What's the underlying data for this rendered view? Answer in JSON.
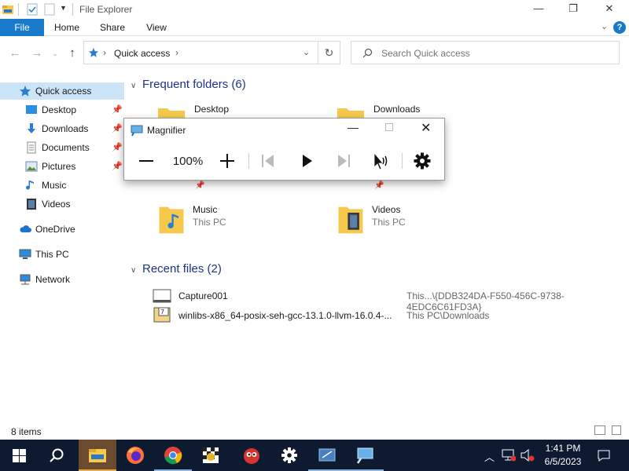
{
  "window": {
    "title": "File Explorer",
    "controls": {
      "minimize": "—",
      "maximize": "❐",
      "close": "✕"
    }
  },
  "ribbon": {
    "tabs": [
      "File",
      "Home",
      "Share",
      "View"
    ],
    "expand_icon": "chevron-down-icon",
    "help": "?"
  },
  "address": {
    "crumb": "Quick access",
    "search_placeholder": "Search Quick access"
  },
  "nav": {
    "quick_access": "Quick access",
    "pinned": [
      {
        "label": "Desktop",
        "icon": "desktop-icon",
        "pinned": true
      },
      {
        "label": "Downloads",
        "icon": "downloads-icon",
        "pinned": true
      },
      {
        "label": "Documents",
        "icon": "documents-icon",
        "pinned": true
      },
      {
        "label": "Pictures",
        "icon": "pictures-icon",
        "pinned": true
      },
      {
        "label": "Music",
        "icon": "music-icon",
        "pinned": false
      },
      {
        "label": "Videos",
        "icon": "videos-icon",
        "pinned": false
      }
    ],
    "onedrive": "OneDrive",
    "thispc": "This PC",
    "network": "Network"
  },
  "content": {
    "frequent_header": "Frequent folders (6)",
    "folders": [
      {
        "name": "Desktop",
        "sub": ""
      },
      {
        "name": "Downloads",
        "sub": ""
      },
      {
        "name": "Music",
        "sub": "This PC"
      },
      {
        "name": "Videos",
        "sub": "This PC"
      }
    ],
    "recent_header": "Recent files (2)",
    "recent": [
      {
        "name": "Capture001",
        "location": "This...\\{DDB324DA-F550-456C-9738-4EDC6C61FD3A}"
      },
      {
        "name": "winlibs-x86_64-posix-seh-gcc-13.1.0-llvm-16.0.4-...",
        "location": "This PC\\Downloads"
      }
    ]
  },
  "status": {
    "items": "8 items"
  },
  "magnifier": {
    "title": "Magnifier",
    "zoom": "100%"
  },
  "taskbar": {
    "time": "1:41 PM",
    "date": "6/5/2023"
  },
  "colors": {
    "accent": "#1979ca",
    "taskbar": "#0d1a30",
    "folder": "#f6c94d",
    "selection": "#cce4f7"
  }
}
